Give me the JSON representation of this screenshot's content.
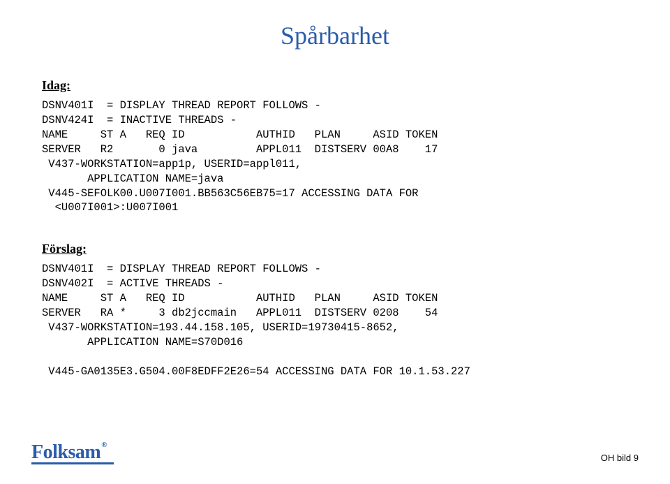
{
  "title": "Spårbarhet",
  "section1": {
    "label": "Idag:",
    "lines": [
      "DSNV401I  = DISPLAY THREAD REPORT FOLLOWS -",
      "DSNV424I  = INACTIVE THREADS -",
      "NAME     ST A   REQ ID           AUTHID   PLAN     ASID TOKEN",
      "SERVER   R2       0 java         APPL011  DISTSERV 00A8    17",
      " V437-WORKSTATION=app1p, USERID=appl011,",
      "       APPLICATION NAME=java",
      " V445-SEFOLK00.U007I001.BB563C56EB75=17 ACCESSING DATA FOR",
      "  <U007I001>:U007I001"
    ]
  },
  "section2": {
    "label": "Förslag:",
    "lines": [
      "DSNV401I  = DISPLAY THREAD REPORT FOLLOWS -",
      "DSNV402I  = ACTIVE THREADS -",
      "NAME     ST A   REQ ID           AUTHID   PLAN     ASID TOKEN",
      "SERVER   RA *     3 db2jccmain   APPL011  DISTSERV 0208    54",
      " V437-WORKSTATION=193.44.158.105, USERID=19730415-8652,",
      "       APPLICATION NAME=S70D016",
      "",
      " V445-GA0135E3.G504.00F8EDFF2E26=54 ACCESSING DATA FOR 10.1.53.227"
    ]
  },
  "logo": {
    "text": "Folksam",
    "tm": "®"
  },
  "slideNum": "OH bild 9"
}
